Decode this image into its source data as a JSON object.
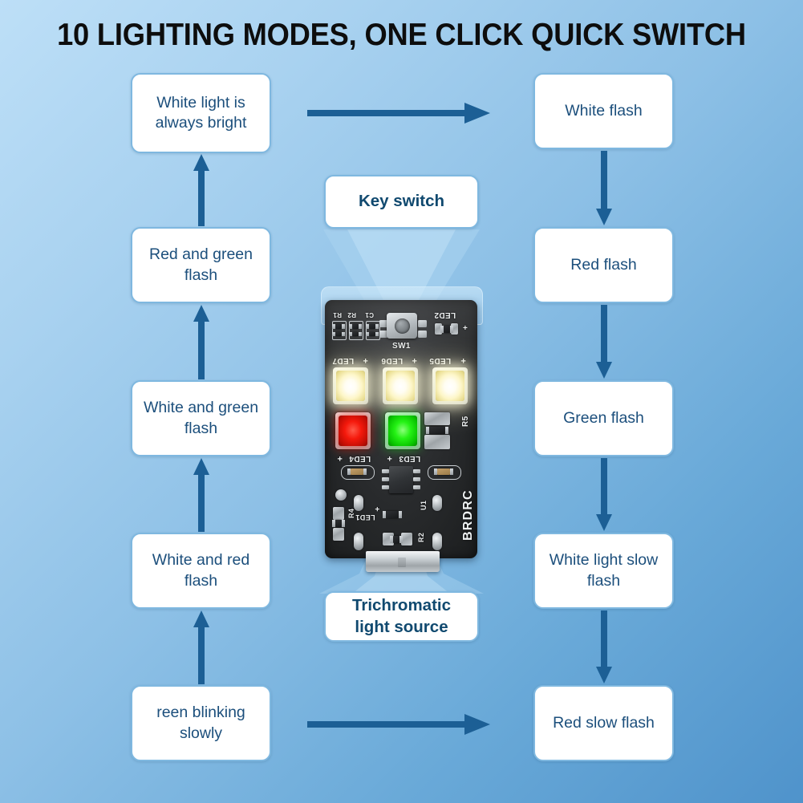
{
  "title": "10 LIGHTING MODES, ONE CLICK QUICK SWITCH",
  "colors": {
    "background_light": "#bddff7",
    "background_dark": "#4f93cb",
    "box_border": "#7fb8e0",
    "box_fill": "#ffffff",
    "box_text": "#1c4f7c",
    "arrow": "#1c5f95",
    "title_text": "#0d0d0d",
    "led_red": "#f5190c",
    "led_green": "#25f215",
    "led_white": "#fffdf2",
    "pcb": "#1b1d1e"
  },
  "callouts": {
    "key_switch": "Key switch",
    "light_source": "Trichromatic light source"
  },
  "left_column": [
    {
      "id": "white-always-bright",
      "label": "White light is always bright"
    },
    {
      "id": "red-green-flash",
      "label": "Red and green flash"
    },
    {
      "id": "white-green-flash",
      "label": "White and green flash"
    },
    {
      "id": "white-red-flash",
      "label": "White and red flash"
    },
    {
      "id": "green-blinking-slowly",
      "label": "reen blinking slowly"
    }
  ],
  "right_column": [
    {
      "id": "white-flash",
      "label": "White flash"
    },
    {
      "id": "red-flash",
      "label": "Red flash"
    },
    {
      "id": "green-flash",
      "label": "Green flash"
    },
    {
      "id": "white-slow-flash",
      "label": "White light slow flash"
    },
    {
      "id": "red-slow-flash",
      "label": "Red slow flash"
    }
  ],
  "arrows": {
    "top_horizontal": "arrow-right",
    "bottom_horizontal": "arrow-right",
    "right_downs": [
      "arrow-down",
      "arrow-down",
      "arrow-down",
      "arrow-down"
    ],
    "left_ups": [
      "arrow-up",
      "arrow-up",
      "arrow-up",
      "arrow-up"
    ]
  },
  "board": {
    "brand": "BRDRC",
    "switch_label": "SW1",
    "silkscreen": [
      "LED2",
      "LED7",
      "LED6",
      "LED5",
      "LED4",
      "LED3",
      "LED1",
      "R5",
      "R4",
      "R2",
      "R1",
      "C1",
      "U1",
      "SW1"
    ],
    "led_markers": {
      "led7": "LED7",
      "led6": "LED6",
      "led5": "LED5",
      "led4": "LED4",
      "led3": "LED3",
      "led2": "LED2",
      "led1": "LED1",
      "plus": "+"
    },
    "resistors": {
      "r5": "R5",
      "r4": "R4",
      "r2": "R2",
      "r1": "R1"
    },
    "ic": "U1"
  }
}
